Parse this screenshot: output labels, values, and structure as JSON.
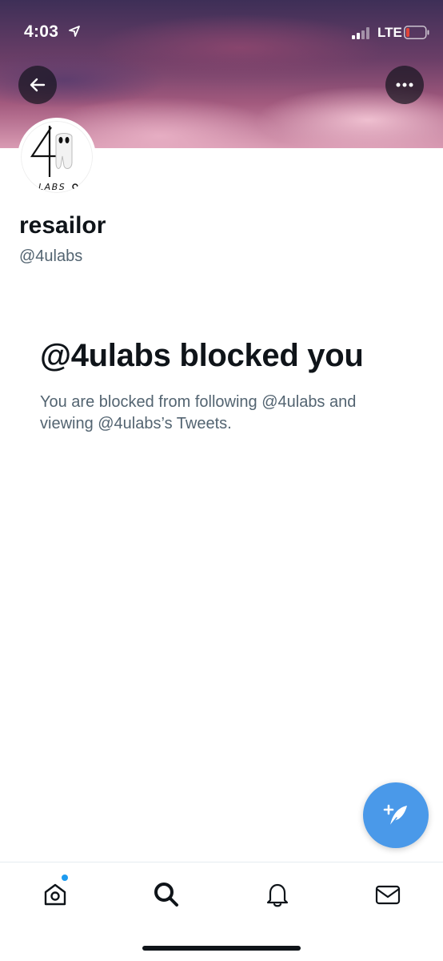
{
  "status_bar": {
    "time": "4:03",
    "network": "LTE"
  },
  "profile": {
    "display_name": "resailor",
    "handle": "@4ulabs",
    "avatar_text": "4 LABS"
  },
  "blocked_notice": {
    "title": "@4ulabs blocked you",
    "description": "You are blocked from following @4ulabs and viewing @4ulabs’s Tweets."
  },
  "icons": {
    "back": "arrow-left-icon",
    "more": "ellipsis-icon",
    "compose": "compose-tweet-icon",
    "home": "home-icon",
    "search": "search-icon",
    "notifications": "bell-icon",
    "messages": "envelope-icon"
  },
  "colors": {
    "accent": "#4a99e9",
    "battery_low": "#e0453a",
    "notification_dot": "#1d9bf0"
  }
}
